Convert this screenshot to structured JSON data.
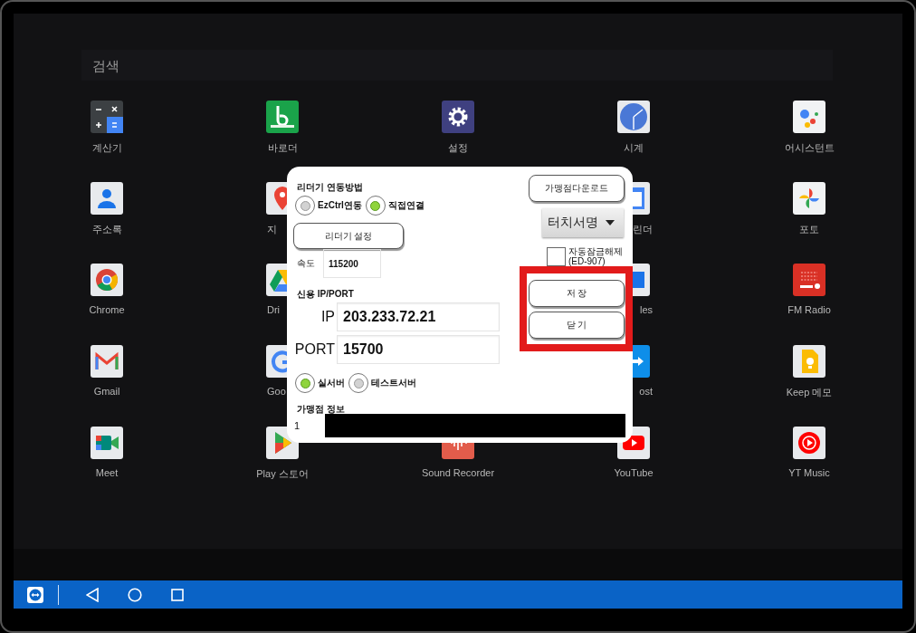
{
  "screen": {
    "search": {
      "placeholder": "검색"
    },
    "apps": [
      {
        "kind": "app",
        "label": "계산기"
      },
      {
        "kind": "app",
        "label": "바로더"
      },
      {
        "kind": "app",
        "label": "설정"
      },
      {
        "kind": "app",
        "label": "시계"
      },
      {
        "kind": "app",
        "label": "어시스턴트"
      },
      {
        "kind": "app",
        "label": "주소록"
      },
      {
        "kind": "app",
        "label": "지"
      },
      {
        "kind": "empty"
      },
      {
        "kind": "app",
        "label": "린더"
      },
      {
        "kind": "app",
        "label": "포토"
      },
      {
        "kind": "app",
        "label": "Chrome"
      },
      {
        "kind": "app",
        "label": "Dri"
      },
      {
        "kind": "empty"
      },
      {
        "kind": "app",
        "label": "les"
      },
      {
        "kind": "app",
        "label": "FM Radio"
      },
      {
        "kind": "app",
        "label": "Gmail"
      },
      {
        "kind": "app",
        "label": "Goo"
      },
      {
        "kind": "empty"
      },
      {
        "kind": "app",
        "label": "ost"
      },
      {
        "kind": "app",
        "label": "Keep 메모"
      },
      {
        "kind": "app",
        "label": "Meet"
      },
      {
        "kind": "app",
        "label": "Play 스토어"
      },
      {
        "kind": "app",
        "label": "Sound Recorder"
      },
      {
        "kind": "app",
        "label": "YouTube"
      },
      {
        "kind": "app",
        "label": "YT Music"
      }
    ]
  },
  "dialog": {
    "reader_method": {
      "title": "리더기 연동방법",
      "options": [
        {
          "label": "EzCtrl연동",
          "selected": false
        },
        {
          "label": "직접연결",
          "selected": true
        }
      ]
    },
    "reader_settings_button": "리더기 설정",
    "speed": {
      "label": "속도",
      "value": "115200"
    },
    "credit": {
      "title": "신용 IP/PORT",
      "ip": {
        "label": "IP",
        "value": "203.233.72.21"
      },
      "port": {
        "label": "PORT",
        "value": "15700"
      }
    },
    "server": {
      "options": [
        {
          "label": "실서버",
          "selected": true
        },
        {
          "label": "테스트서버",
          "selected": false
        }
      ]
    },
    "merchant": {
      "title": "가맹점 정보",
      "index": "1"
    },
    "download_button": "가맹점다운로드",
    "signature_dropdown": {
      "value": "터치서명"
    },
    "auto_unlock": {
      "label": "자동잠금해제(ED-907)",
      "checked": false
    },
    "actions": {
      "highlighted": true,
      "buttons": [
        "저 장",
        "닫 기"
      ]
    }
  }
}
